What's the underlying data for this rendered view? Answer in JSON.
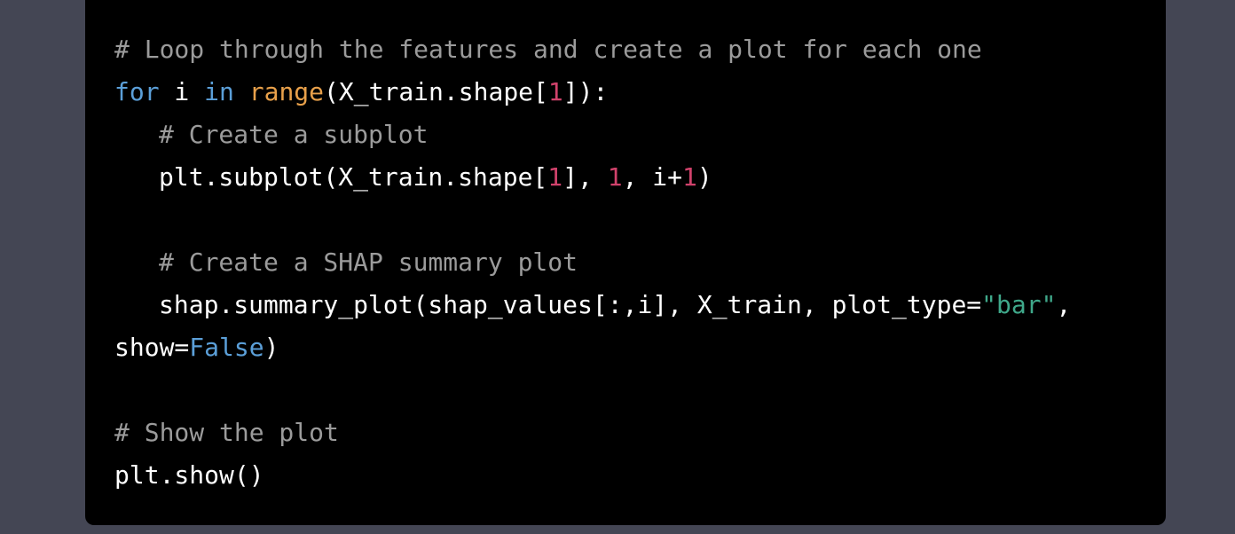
{
  "code": {
    "line1_comment": "# Loop through the features and create a plot for each one",
    "line2_for": "for",
    "line2_i": " i ",
    "line2_in": "in",
    "line2_sp": " ",
    "line2_range": "range",
    "line2_arg_open": "(X_train.shape[",
    "line2_num": "1",
    "line2_arg_close": "]):",
    "line3_comment": "# Create a subplot",
    "line4_call_open": "plt.subplot(X_train.shape[",
    "line4_num1": "1",
    "line4_mid1": "], ",
    "line4_num2": "1",
    "line4_mid2": ", i+",
    "line4_num3": "1",
    "line4_close": ")",
    "line6_comment": "# Create a SHAP summary plot",
    "line7_call": "shap.summary_plot(shap_values[:,i], X_train, plot_type=",
    "line7_str": "\"bar\"",
    "line7_end": ",",
    "line8_show": "show=",
    "line8_false": "False",
    "line8_close": ")",
    "line10_comment": "# Show the plot",
    "line11_call": "plt.show()"
  },
  "colors": {
    "page_background": "#444654",
    "panel_background": "#000000",
    "text": "#ffffff",
    "comment": "#9b9b9b",
    "keyword": "#5b9fd8",
    "builtin": "#e8a04a",
    "number": "#d0426b",
    "string": "#3fa88a"
  }
}
